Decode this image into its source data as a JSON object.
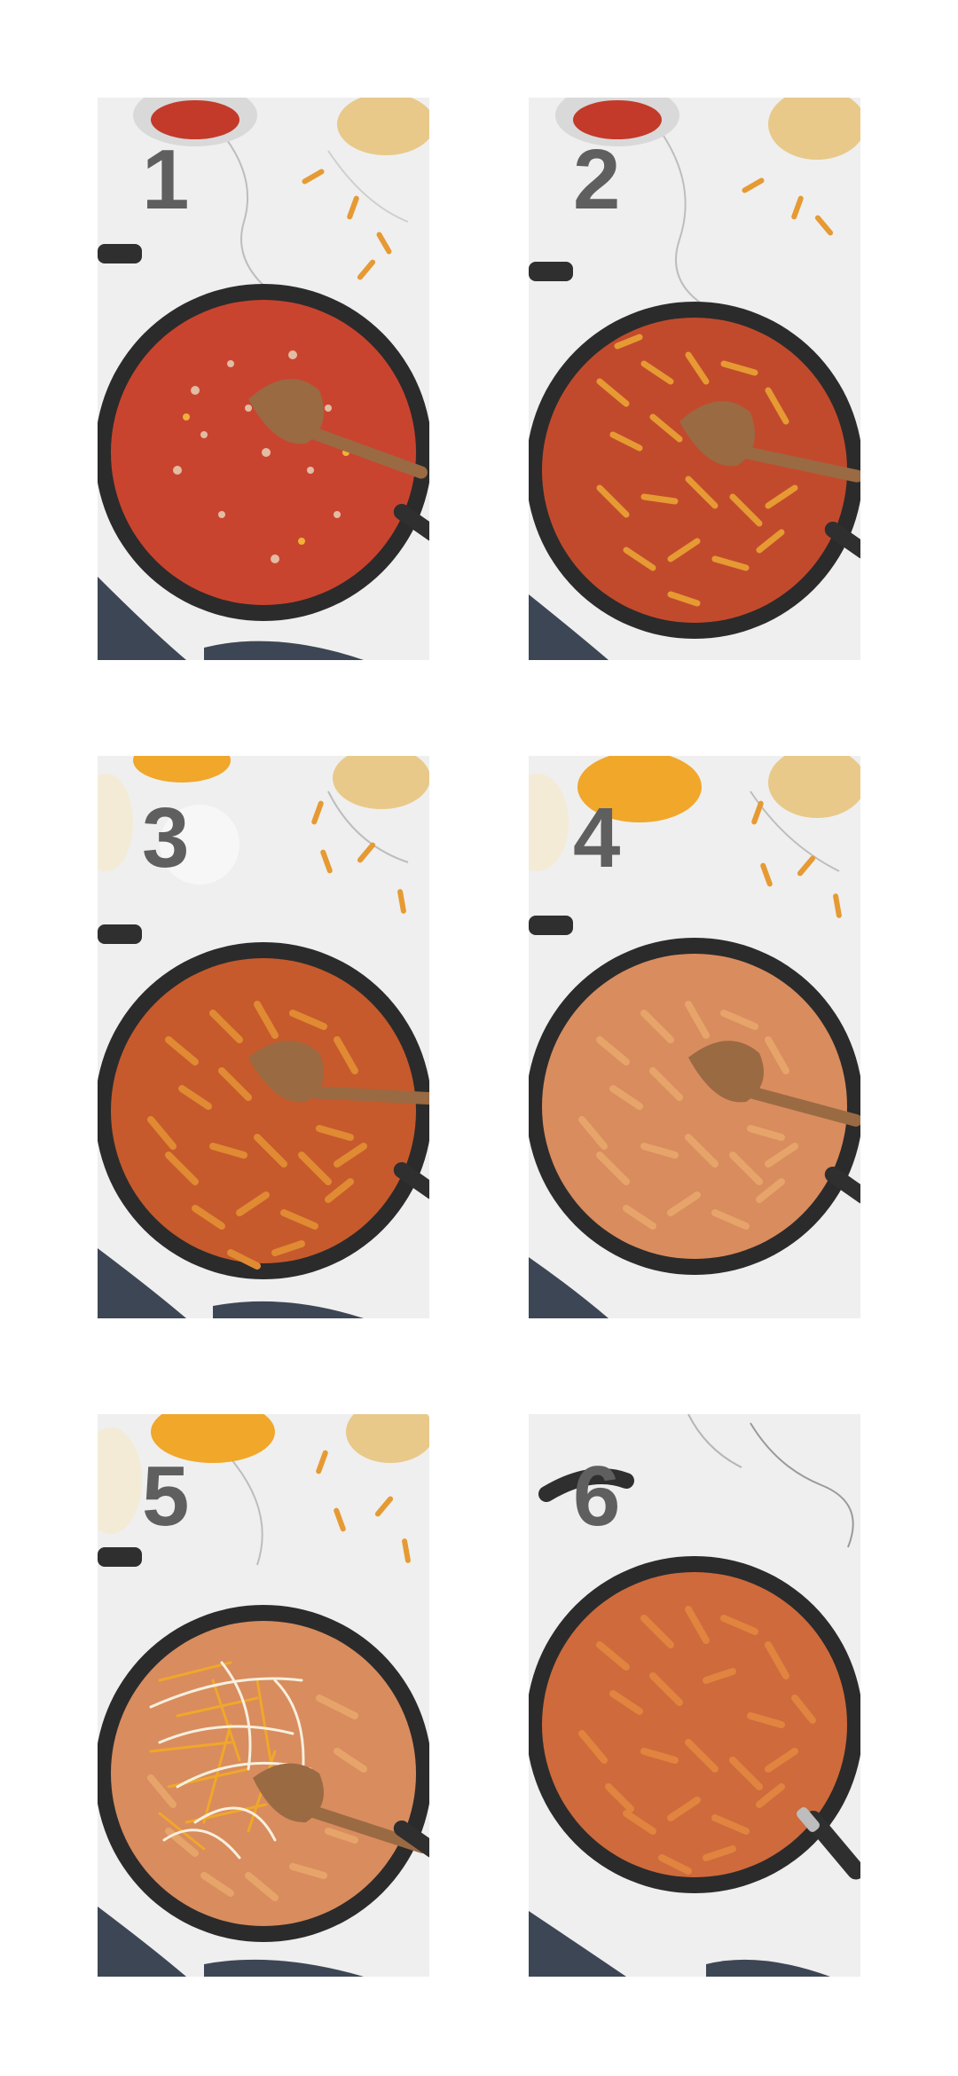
{
  "steps": [
    {
      "number": "1",
      "sauce_color": "#c9442f"
    },
    {
      "number": "2",
      "sauce_color": "#c24a2c"
    },
    {
      "number": "3",
      "sauce_color": "#c65a2c"
    },
    {
      "number": "4",
      "sauce_color": "#d98c5e"
    },
    {
      "number": "5",
      "sauce_color": "#d98c5e"
    },
    {
      "number": "6",
      "sauce_color": "#cf6a3c"
    }
  ],
  "colors": {
    "marble": "#eeeeee",
    "pan": "#2b2b2b",
    "pasta": "#e69a33",
    "spoon": "#9a6a43",
    "towel": "#3d4654",
    "cheese_cheddar": "#f0a72a",
    "cheese_white": "#f3ebd6"
  }
}
